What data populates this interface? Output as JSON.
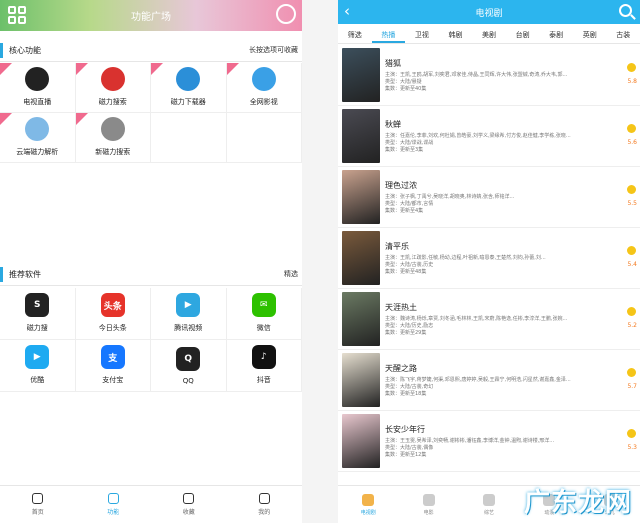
{
  "left": {
    "header": {
      "title": "功能广场"
    },
    "core": {
      "title": "核心功能",
      "extra": "长按选项可收藏",
      "tiles": [
        {
          "label": "电视直播",
          "icon": "tv-icon",
          "color": "#222222"
        },
        {
          "label": "磁力搜索",
          "icon": "magnet-search-icon",
          "color": "#d9322f"
        },
        {
          "label": "磁力下载器",
          "icon": "magnet-download-icon",
          "color": "#2b8fd8"
        },
        {
          "label": "全网影视",
          "icon": "all-video-icon",
          "color": "#3aa0e6",
          "text": "全网\n影视"
        },
        {
          "label": "云端磁力解析",
          "icon": "cloud-icon",
          "color": "#7fb9e6"
        },
        {
          "label": "新磁力搜索",
          "icon": "new-magnet-icon",
          "color": "#8a8a8a"
        }
      ]
    },
    "recommend": {
      "title": "推荐软件",
      "extra": "精选",
      "apps": [
        {
          "label": "磁力搜",
          "icon": "magnet-app-icon",
          "color": "#222222",
          "text": "S"
        },
        {
          "label": "今日头条",
          "icon": "toutiao-icon",
          "color": "#e6332a",
          "text": "头条"
        },
        {
          "label": "腾讯视频",
          "icon": "tencent-video-icon",
          "color": "#2ea7e0",
          "text": "▶"
        },
        {
          "label": "微信",
          "icon": "wechat-icon",
          "color": "#2dc100",
          "text": "✉"
        },
        {
          "label": "优酷",
          "icon": "youku-icon",
          "color": "#1eaaf1",
          "text": "▶"
        },
        {
          "label": "支付宝",
          "icon": "alipay-icon",
          "color": "#1677ff",
          "text": "支"
        },
        {
          "label": "QQ",
          "icon": "qq-icon",
          "color": "#222222",
          "text": "Q"
        },
        {
          "label": "抖音",
          "icon": "douyin-icon",
          "color": "#111111",
          "text": "♪"
        }
      ]
    },
    "nav": [
      {
        "label": "首页",
        "icon": "home-icon",
        "active": false
      },
      {
        "label": "功能",
        "icon": "function-icon",
        "active": true
      },
      {
        "label": "收藏",
        "icon": "favorite-icon",
        "active": false
      },
      {
        "label": "我的",
        "icon": "profile-icon",
        "active": false
      }
    ]
  },
  "right": {
    "header": {
      "title": "电视剧"
    },
    "tabs": [
      "筛选",
      "热播",
      "卫视",
      "韩剧",
      "美剧",
      "台剧",
      "泰剧",
      "英剧",
      "古装"
    ],
    "active_tab": 1,
    "shows": [
      {
        "name": "猎狐",
        "cast": "主演：王凯,王鸥,胡军,刘奕君,邓家佳,侍晶,王同辉,许大伟,张盟铖,奇涛,乔大韦,郭...",
        "type": "类型：大陆/悬疑",
        "episodes": "集数：更新至40集",
        "score": "5.8",
        "color": "#3c4f5c"
      },
      {
        "name": "秋蝉",
        "cast": "主演：任嘉伦,李菲,刘欢,何杜娟,曾皓豪,刘学义,梁缘希,付方俊,赵佳健,李学栋,张晓...",
        "type": "类型：大陆/谍战,谍战",
        "episodes": "集数：更新至3集",
        "score": "5.6",
        "color": "#4a4a52"
      },
      {
        "name": "理色过浓",
        "cast": "主演：张子枫,丁禹兮,吴晓洋,胡晓奥,林诗婧,张含,师铭洋...",
        "type": "类型：大陆/都市,言情",
        "episodes": "集数：更新至4集",
        "score": "5.5",
        "color": "#c9a28e"
      },
      {
        "name": "清平乐",
        "cast": "主演：王凯,江疏影,任敏,杨幼,边程,叶祖新,喻恩泰,王楚然,刘钧,孙蕾,刘...",
        "type": "类型：大陆/古装,历史",
        "episodes": "集数：更新至48集",
        "score": "5.4",
        "color": "#7a5a3c"
      },
      {
        "name": "天涯热土",
        "cast": "主演：魏诗涛,杨烁,章贾,刘冬涵,毛林林,王凯,宋蔚,陈艳逸,任彬,李淳洋,王鹏,张婉...",
        "type": "类型：大陆/历史,励志",
        "episodes": "集数：更新至29集",
        "score": "5.2",
        "color": "#6b7a63"
      },
      {
        "name": "天醒之路",
        "cast": "主演：陈飞宇,蒋梦婕,何渠,邓恩熙,唐婷婷,吴毅,王霖宁,何明浩,闪星然,谢嘉鑫,金泽...",
        "type": "类型：大陆/古装,奇幻",
        "episodes": "集数：更新至18集",
        "score": "5.7",
        "color": "#e6dfd0"
      },
      {
        "name": "长安少年行",
        "cast": "主演：王玉雯,吴希泽,刘奕畅,谢彬彬,潘钰鑫,李博洋,金钟,温煦,谢诗楼,邢洋...",
        "type": "类型：大陆/古装,偶像",
        "episodes": "集数：更新至12集",
        "score": "5.3",
        "color": "#e9c8cf"
      }
    ],
    "nav": [
      {
        "label": "电视剧",
        "icon": "tv-series-icon",
        "active": true
      },
      {
        "label": "电影",
        "icon": "movie-icon",
        "active": false
      },
      {
        "label": "综艺",
        "icon": "variety-icon",
        "active": false
      },
      {
        "label": "动漫",
        "icon": "anime-icon",
        "active": false
      },
      {
        "label": "少儿",
        "icon": "kids-icon",
        "active": false
      }
    ],
    "watermark": "广东龙网"
  }
}
